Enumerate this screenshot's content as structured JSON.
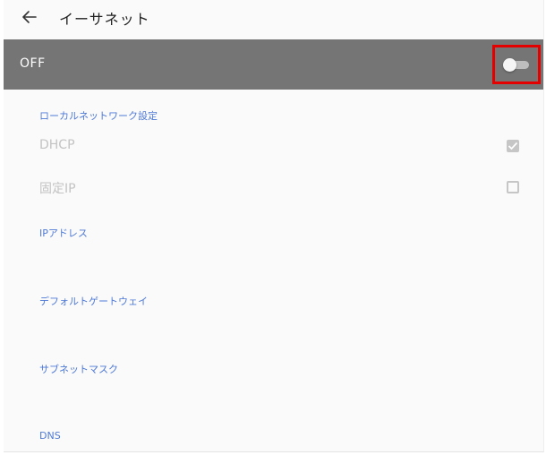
{
  "header": {
    "title": "イーサネット",
    "back_icon": "arrow-left-icon"
  },
  "master_switch": {
    "label": "OFF",
    "state": "off",
    "highlighted": true,
    "highlight_color": "#e50000"
  },
  "sections": {
    "local_network": "ローカルネットワーク設定",
    "ip_address": "IPアドレス",
    "default_gateway": "デフォルトゲートウェイ",
    "subnet_mask": "サブネットマスク",
    "dns": "DNS"
  },
  "options": {
    "dhcp": {
      "label": "DHCP",
      "checked": true
    },
    "static_ip": {
      "label": "固定IP",
      "checked": false
    }
  },
  "colors": {
    "accent": "#4f7ad6",
    "bar": "#757575",
    "disabled_text": "#c3c3c3"
  }
}
